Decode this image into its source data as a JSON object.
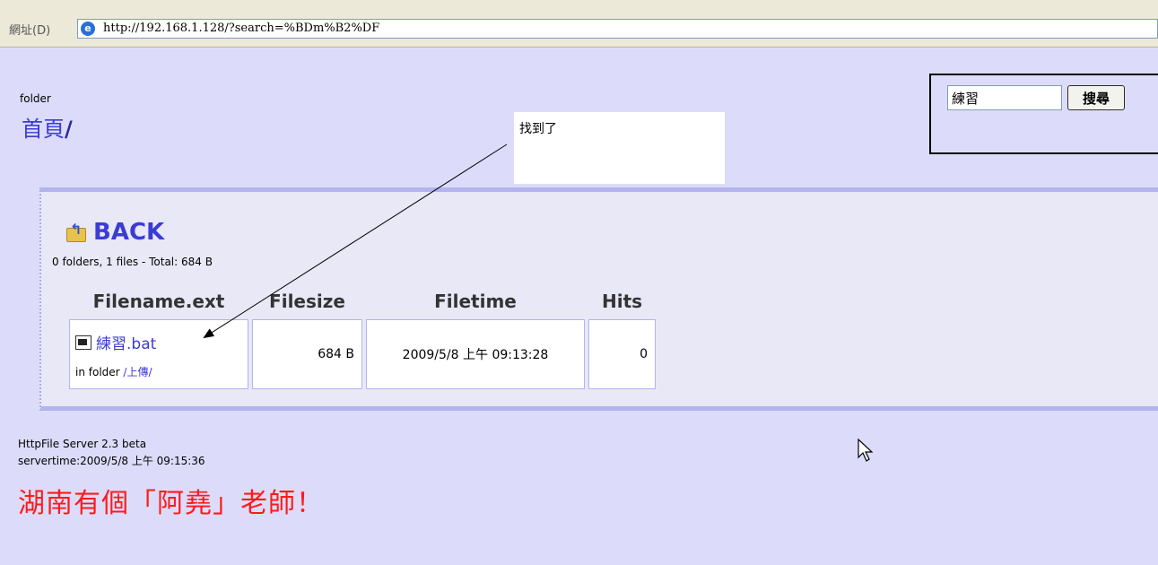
{
  "address_bar": {
    "label": "網址(D)",
    "url": "http://192.168.1.128/?search=%BDm%B2%DF"
  },
  "header": {
    "folder_label": "folder",
    "home_link": "首頁",
    "home_slash": "/"
  },
  "callout": {
    "text": "找到了"
  },
  "search": {
    "value": "練習",
    "button_label": "搜尋"
  },
  "listing": {
    "back_label": "BACK",
    "summary": "0 folders, 1 files - Total: 684 B",
    "columns": [
      "Filename.ext",
      "Filesize",
      "Filetime",
      "Hits"
    ],
    "rows": [
      {
        "filename": "練習.bat",
        "in_folder_label": "in folder",
        "folder_link": "/上傳/",
        "filesize": "684 B",
        "filetime": "2009/5/8 上午 09:13:28",
        "hits": "0"
      }
    ]
  },
  "footer": {
    "server": "HttpFile Server 2.3 beta",
    "servertime": "servertime:2009/5/8 上午 09:15:36",
    "teacher": "湖南有個「阿堯」老師！"
  },
  "colors": {
    "page_bg": "#dcdcfa",
    "link": "#3b3bd6",
    "teacher_text": "#ff1a1a"
  }
}
